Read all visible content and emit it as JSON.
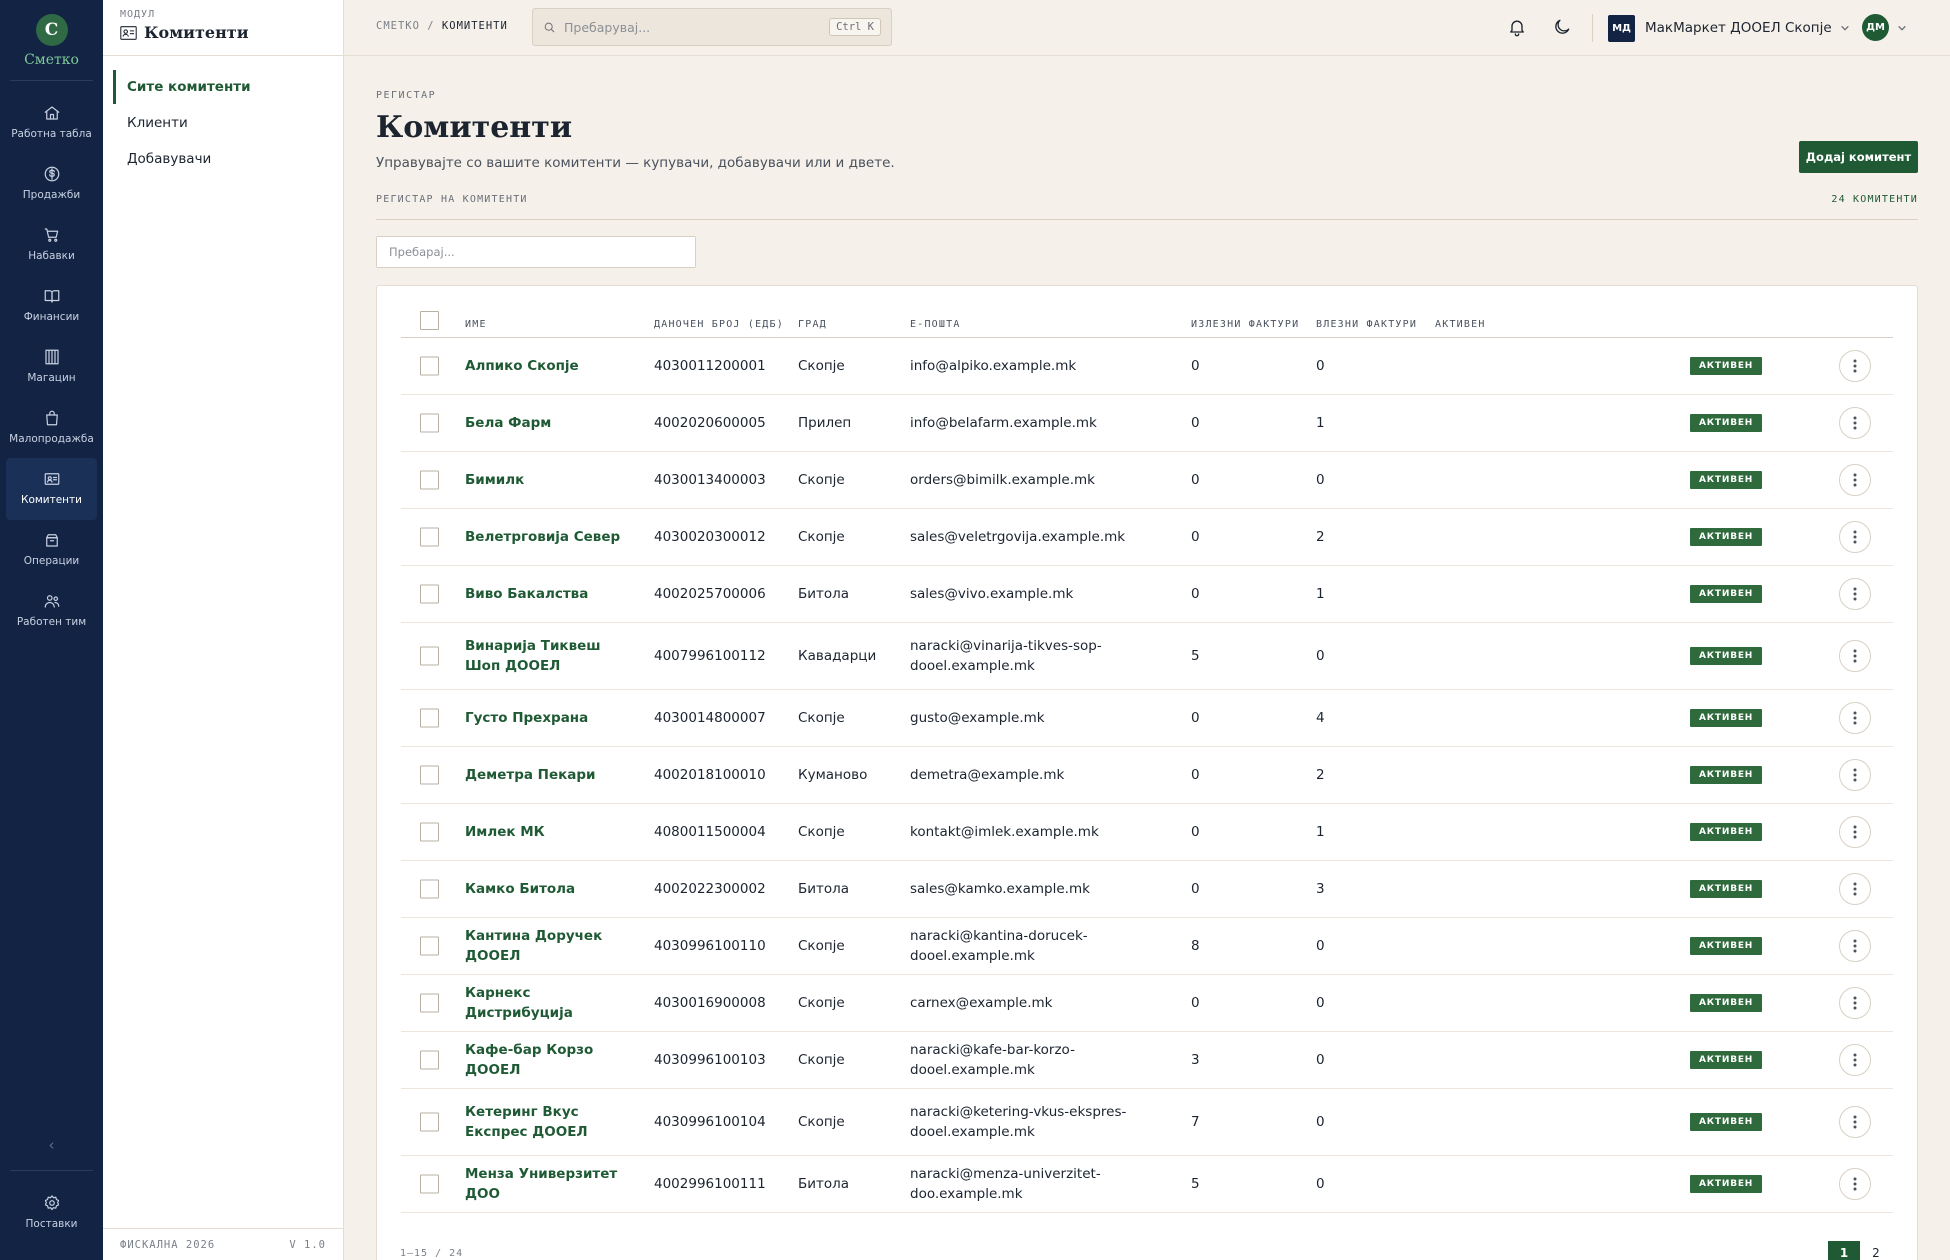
{
  "brand": {
    "letter": "С",
    "name": "Сметко"
  },
  "rail": {
    "items": [
      {
        "label": "Работна табла",
        "icon": "home-icon"
      },
      {
        "label": "Продажби",
        "icon": "dollar-icon"
      },
      {
        "label": "Набавки",
        "icon": "cart-icon"
      },
      {
        "label": "Финансии",
        "icon": "book-icon"
      },
      {
        "label": "Магацин",
        "icon": "warehouse-icon"
      },
      {
        "label": "Малопродажба",
        "icon": "shopping-bag-icon"
      },
      {
        "label": "Комитенти",
        "icon": "contact-card-icon",
        "active": true
      },
      {
        "label": "Операции",
        "icon": "archive-icon"
      },
      {
        "label": "Работен тим",
        "icon": "users-icon"
      }
    ],
    "collapse_glyph": "‹",
    "settings_label": "Поставки"
  },
  "module": {
    "label": "МОДУЛ",
    "title": "Комитенти"
  },
  "subnav": {
    "items": [
      "Сите комитенти",
      "Клиенти",
      "Добавувачи"
    ],
    "active": "Сите комитенти",
    "footer_left": "ФИСКАЛНА 2026",
    "footer_right": "V 1.0"
  },
  "topbar": {
    "crumb_root": "СМЕТКО",
    "crumb_sep": "/",
    "crumb_current": "КОМИТЕНТИ",
    "search_placeholder": "Пребарувај...",
    "shortcut": "Ctrl K",
    "company_initials": "МД",
    "company_name": "МакМаркет ДООЕЛ Скопје",
    "user_initials": "ДМ"
  },
  "page": {
    "eyebrow": "РЕГИСТАР",
    "title": "Комитенти",
    "subtitle": "Управувајте со вашите комитенти — купувачи, добавувачи или и двете.",
    "add_button": "Додај комитент",
    "section_label": "РЕГИСТАР НА КОМИТЕНТИ",
    "count_label": "24 КОМИТЕНТИ",
    "filter_placeholder": "Пребарај..."
  },
  "table": {
    "headers": {
      "name": "ИМЕ",
      "tax": "ДАНОЧЕН БРОЈ (ЕДБ)",
      "city": "ГРАД",
      "email": "Е-ПОШТА",
      "out": "ИЗЛЕЗНИ ФАКТУРИ",
      "in": "ВЛЕЗНИ ФАКТУРИ",
      "active": "АКТИВЕН"
    },
    "rows": [
      {
        "name": "Алпико Скопје",
        "tax": "4030011200001",
        "city": "Скопје",
        "email": "info@alpiko.example.mk",
        "out": "0",
        "in": "0",
        "status": "АКТИВЕН"
      },
      {
        "name": "Бела Фарм",
        "tax": "4002020600005",
        "city": "Прилеп",
        "email": "info@belafarm.example.mk",
        "out": "0",
        "in": "1",
        "status": "АКТИВЕН"
      },
      {
        "name": "Бимилк",
        "tax": "4030013400003",
        "city": "Скопје",
        "email": "orders@bimilk.example.mk",
        "out": "0",
        "in": "0",
        "status": "АКТИВЕН"
      },
      {
        "name": "Велетрговија Север",
        "tax": "4030020300012",
        "city": "Скопје",
        "email": "sales@veletrgovija.example.mk",
        "out": "0",
        "in": "2",
        "status": "АКТИВЕН"
      },
      {
        "name": "Виво Бакалства",
        "tax": "4002025700006",
        "city": "Битола",
        "email": "sales@vivo.example.mk",
        "out": "0",
        "in": "1",
        "status": "АКТИВЕН"
      },
      {
        "name": "Винарија Тиквеш Шоп ДООЕЛ",
        "tax": "4007996100112",
        "city": "Кавадарци",
        "email": "naracki@vinarija-tikves-sop-dooel.example.mk",
        "out": "5",
        "in": "0",
        "status": "АКТИВЕН"
      },
      {
        "name": "Густо Прехрана",
        "tax": "4030014800007",
        "city": "Скопје",
        "email": "gusto@example.mk",
        "out": "0",
        "in": "4",
        "status": "АКТИВЕН"
      },
      {
        "name": "Деметра Пекари",
        "tax": "4002018100010",
        "city": "Куманово",
        "email": "demetra@example.mk",
        "out": "0",
        "in": "2",
        "status": "АКТИВЕН"
      },
      {
        "name": "Имлек МК",
        "tax": "4080011500004",
        "city": "Скопје",
        "email": "kontakt@imlek.example.mk",
        "out": "0",
        "in": "1",
        "status": "АКТИВЕН"
      },
      {
        "name": "Камко Битола",
        "tax": "4002022300002",
        "city": "Битола",
        "email": "sales@kamko.example.mk",
        "out": "0",
        "in": "3",
        "status": "АКТИВЕН"
      },
      {
        "name": "Кантина Доручек ДООЕЛ",
        "tax": "4030996100110",
        "city": "Скопје",
        "email": "naracki@kantina-dorucek-dooel.example.mk",
        "out": "8",
        "in": "0",
        "status": "АКТИВЕН"
      },
      {
        "name": "Карнекс Дистрибуција",
        "tax": "4030016900008",
        "city": "Скопје",
        "email": "carnex@example.mk",
        "out": "0",
        "in": "0",
        "status": "АКТИВЕН"
      },
      {
        "name": "Кафе-бар Корзо ДООЕЛ",
        "tax": "4030996100103",
        "city": "Скопје",
        "email": "naracki@kafe-bar-korzo-dooel.example.mk",
        "out": "3",
        "in": "0",
        "status": "АКТИВЕН"
      },
      {
        "name": "Кетеринг Вкус Експрес ДООЕЛ",
        "tax": "4030996100104",
        "city": "Скопје",
        "email": "naracki@ketering-vkus-ekspres-dooel.example.mk",
        "out": "7",
        "in": "0",
        "status": "АКТИВЕН"
      },
      {
        "name": "Менза Универзитет ДОО",
        "tax": "4002996100111",
        "city": "Битола",
        "email": "naracki@menza-univerzitet-doo.example.mk",
        "out": "5",
        "in": "0",
        "status": "АКТИВЕН"
      }
    ]
  },
  "pager": {
    "info": "1–15 / 24",
    "pages": [
      "1",
      "2"
    ]
  },
  "colors": {
    "accent": "#1f5a35",
    "rail": "#132343",
    "background": "#f5f0e9"
  }
}
